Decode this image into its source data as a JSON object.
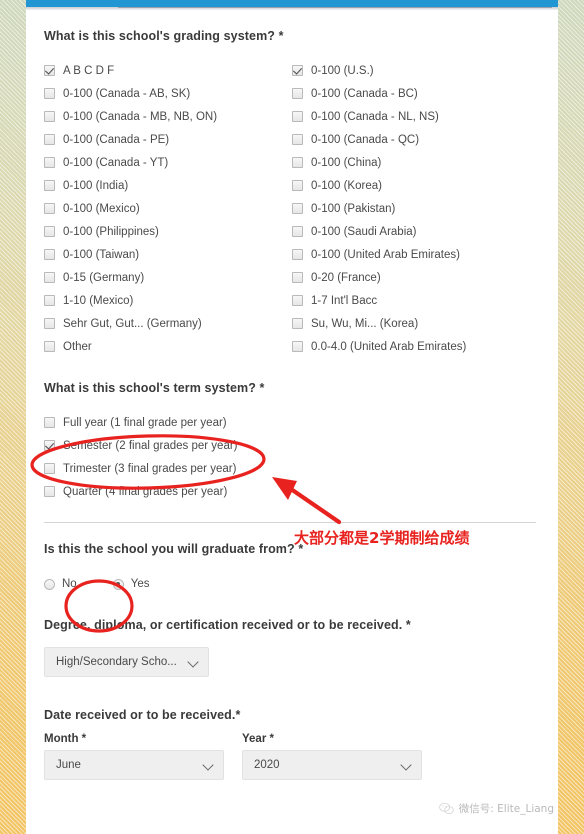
{
  "form": {
    "grading_question": "What is this school's grading system? *",
    "grading_options_left": [
      {
        "label": "A B C D F",
        "checked": true
      },
      {
        "label": "0-100 (Canada - AB, SK)",
        "checked": false
      },
      {
        "label": "0-100 (Canada - MB, NB, ON)",
        "checked": false
      },
      {
        "label": "0-100 (Canada - PE)",
        "checked": false
      },
      {
        "label": "0-100 (Canada - YT)",
        "checked": false
      },
      {
        "label": "0-100 (India)",
        "checked": false
      },
      {
        "label": "0-100 (Mexico)",
        "checked": false
      },
      {
        "label": "0-100 (Philippines)",
        "checked": false
      },
      {
        "label": "0-100 (Taiwan)",
        "checked": false
      },
      {
        "label": "0-15 (Germany)",
        "checked": false
      },
      {
        "label": "1-10 (Mexico)",
        "checked": false
      },
      {
        "label": "Sehr Gut, Gut... (Germany)",
        "checked": false
      },
      {
        "label": "Other",
        "checked": false
      }
    ],
    "grading_options_right": [
      {
        "label": "0-100 (U.S.)",
        "checked": true
      },
      {
        "label": "0-100 (Canada - BC)",
        "checked": false
      },
      {
        "label": "0-100 (Canada - NL, NS)",
        "checked": false
      },
      {
        "label": "0-100 (Canada - QC)",
        "checked": false
      },
      {
        "label": "0-100 (China)",
        "checked": false
      },
      {
        "label": "0-100 (Korea)",
        "checked": false
      },
      {
        "label": "0-100 (Pakistan)",
        "checked": false
      },
      {
        "label": "0-100 (Saudi Arabia)",
        "checked": false
      },
      {
        "label": "0-100 (United Arab Emirates)",
        "checked": false
      },
      {
        "label": "0-20 (France)",
        "checked": false
      },
      {
        "label": "1-7 Int'l Bacc",
        "checked": false
      },
      {
        "label": "Su, Wu, Mi... (Korea)",
        "checked": false
      },
      {
        "label": "0.0-4.0 (United Arab Emirates)",
        "checked": false
      }
    ],
    "term_question": "What is this school's term system? *",
    "term_options": [
      {
        "label": "Full year (1 final grade per year)",
        "checked": false
      },
      {
        "label": "Semester (2 final grades per year)",
        "checked": true
      },
      {
        "label": "Trimester (3 final grades per year)",
        "checked": false
      },
      {
        "label": "Quarter (4 final grades per year)",
        "checked": false
      }
    ],
    "graduate_question": "Is this the school you will graduate from? *",
    "graduate_options": [
      {
        "label": "No",
        "checked": false
      },
      {
        "label": "Yes",
        "checked": true
      }
    ],
    "degree_question": "Degree, diploma, or certification received or to be received. *",
    "degree_value": "High/Secondary Scho...",
    "date_question": "Date received or to be received.*",
    "month_label": "Month *",
    "month_value": "June",
    "year_label": "Year *",
    "year_value": "2020"
  },
  "annotations": {
    "chinese_note": "大部分都是2学期制给成绩",
    "color": "#e8231f"
  },
  "watermark": {
    "text": "微信号: Elite_Liang"
  }
}
